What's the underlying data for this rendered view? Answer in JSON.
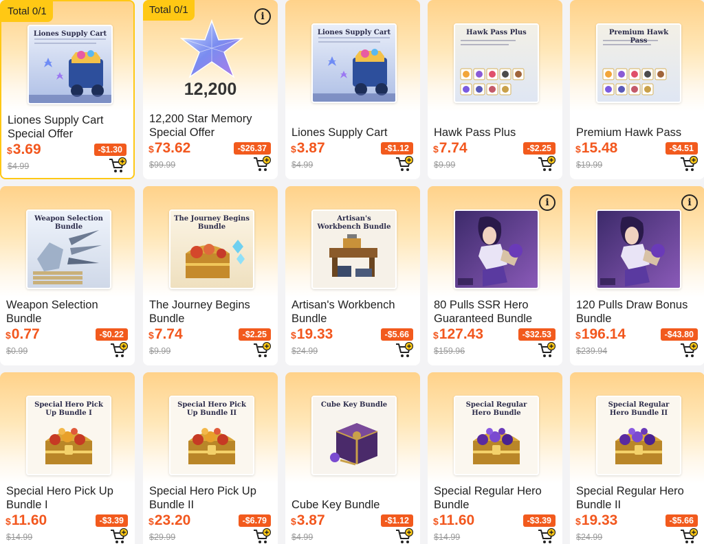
{
  "products": [
    {
      "name": "Liones Supply Cart Special Offer",
      "currency": "$",
      "price": "3.69",
      "discount": "-$1.30",
      "original": "$4.99",
      "badge": "Total 0/1",
      "info": false,
      "selected": true,
      "thumb": "cart",
      "thumb_title": "Liones Supply Cart"
    },
    {
      "name": "12,200 Star Memory Special Offer",
      "currency": "$",
      "price": "73.62",
      "discount": "-$26.37",
      "original": "$99.99",
      "badge": "Total 0/1",
      "info": true,
      "thumb": "star",
      "big_number": "12,200"
    },
    {
      "name": "Liones Supply Cart",
      "currency": "$",
      "price": "3.87",
      "discount": "-$1.12",
      "original": "$4.99",
      "thumb": "cart",
      "thumb_title": "Liones Supply Cart"
    },
    {
      "name": "Hawk Pass Plus",
      "currency": "$",
      "price": "7.74",
      "discount": "-$2.25",
      "original": "$9.99",
      "thumb": "pass",
      "thumb_title": "Hawk Pass Plus"
    },
    {
      "name": "Premium Hawk Pass",
      "currency": "$",
      "price": "15.48",
      "discount": "-$4.51",
      "original": "$19.99",
      "thumb": "pass",
      "thumb_title": "Premium Hawk Pass"
    },
    {
      "name": "Weapon Selection Bundle",
      "currency": "$",
      "price": "0.77",
      "discount": "-$0.22",
      "original": "$0.99",
      "thumb": "weapon",
      "thumb_title": "Weapon Selection Bundle"
    },
    {
      "name": "The Journey Begins Bundle",
      "currency": "$",
      "price": "7.74",
      "discount": "-$2.25",
      "original": "$9.99",
      "thumb": "chest",
      "thumb_title": "The Journey Begins Bundle"
    },
    {
      "name": "Artisan's Workbench Bundle",
      "currency": "$",
      "price": "19.33",
      "discount": "-$5.66",
      "original": "$24.99",
      "thumb": "bench",
      "thumb_title": "Artisan's Workbench Bundle"
    },
    {
      "name": "80 Pulls SSR Hero Guaranteed Bundle",
      "currency": "$",
      "price": "127.43",
      "discount": "-$32.53",
      "original": "$159.96",
      "info": true,
      "thumb": "hero"
    },
    {
      "name": "120 Pulls Draw Bonus Bundle",
      "currency": "$",
      "price": "196.14",
      "discount": "-$43.80",
      "original": "$239.94",
      "info": true,
      "thumb": "hero"
    },
    {
      "name": "Special Hero Pick Up Bundle I",
      "currency": "$",
      "price": "11.60",
      "discount": "-$3.39",
      "original": "$14.99",
      "thumb": "chest-red",
      "thumb_title": "Special Hero Pick Up Bundle I"
    },
    {
      "name": "Special Hero Pick Up Bundle II",
      "currency": "$",
      "price": "23.20",
      "discount": "-$6.79",
      "original": "$29.99",
      "thumb": "chest-red",
      "thumb_title": "Special Hero Pick Up Bundle II"
    },
    {
      "name": "Cube Key Bundle",
      "currency": "$",
      "price": "3.87",
      "discount": "-$1.12",
      "original": "$4.99",
      "thumb": "cube",
      "thumb_title": "Cube Key Bundle"
    },
    {
      "name": "Special Regular Hero Bundle",
      "currency": "$",
      "price": "11.60",
      "discount": "-$3.39",
      "original": "$14.99",
      "thumb": "chest-purple",
      "thumb_title": "Special Regular Hero Bundle"
    },
    {
      "name": "Special Regular Hero Bundle II",
      "currency": "$",
      "price": "19.33",
      "discount": "-$5.66",
      "original": "$24.99",
      "thumb": "chest-purple",
      "thumb_title": "Special Regular Hero Bundle II"
    }
  ],
  "colors": {
    "accent": "#f25a1d",
    "badge": "#ffc814",
    "strike": "#999999"
  }
}
